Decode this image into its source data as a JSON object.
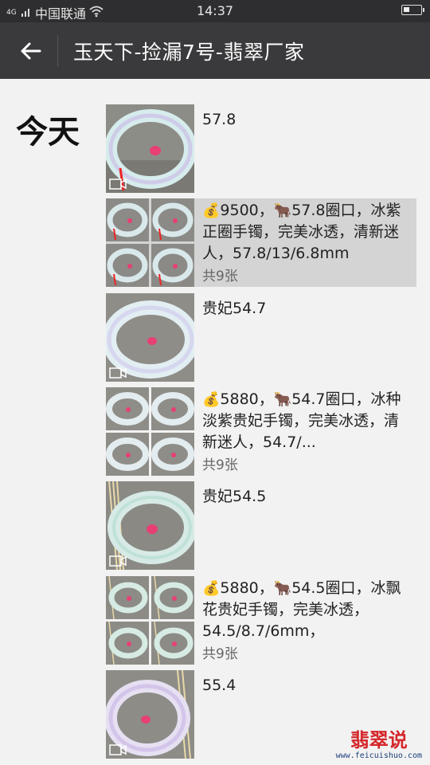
{
  "status_bar": {
    "network": "4G",
    "carrier": "中国联通",
    "time": "14:37",
    "battery_level": 0.35
  },
  "header": {
    "title": "玉天下-捡漏7号-翡翠厂家",
    "back_icon": "arrow-left-icon"
  },
  "feed": {
    "day_label": "今天",
    "items": [
      {
        "type": "video",
        "text": "57.8"
      },
      {
        "type": "album",
        "price_emoji": "💰",
        "cow_emoji": "🐂",
        "price": "9500，",
        "size": "57.8圈口，冰紫正圈手镯，完美冰透，清新迷人，57.8/13/6.8mm",
        "count": "共9张"
      },
      {
        "type": "video",
        "text": "贵妃54.7"
      },
      {
        "type": "album",
        "price_emoji": "💰",
        "cow_emoji": "🐂",
        "price": "5880，",
        "size": "54.7圈口，冰种淡紫贵妃手镯，完美冰透，清新迷人，54.7/...",
        "count": "共9张"
      },
      {
        "type": "video",
        "text": "贵妃54.5"
      },
      {
        "type": "album",
        "price_emoji": "💰",
        "cow_emoji": "🐂",
        "price": "5880，",
        "size": "54.5圈口，冰飘花贵妃手镯，完美冰透，54.5/8.7/6mm，",
        "count": "共9张"
      },
      {
        "type": "video",
        "text": "55.4"
      }
    ]
  },
  "watermark": {
    "name": "翡翠说",
    "url": "www.feicuishuo.com"
  },
  "colors": {
    "status_bg": "#2e2e30",
    "header_bg": "#3a3a3c",
    "highlight": "#d4d4d4",
    "watermark_red": "#d5272b"
  }
}
